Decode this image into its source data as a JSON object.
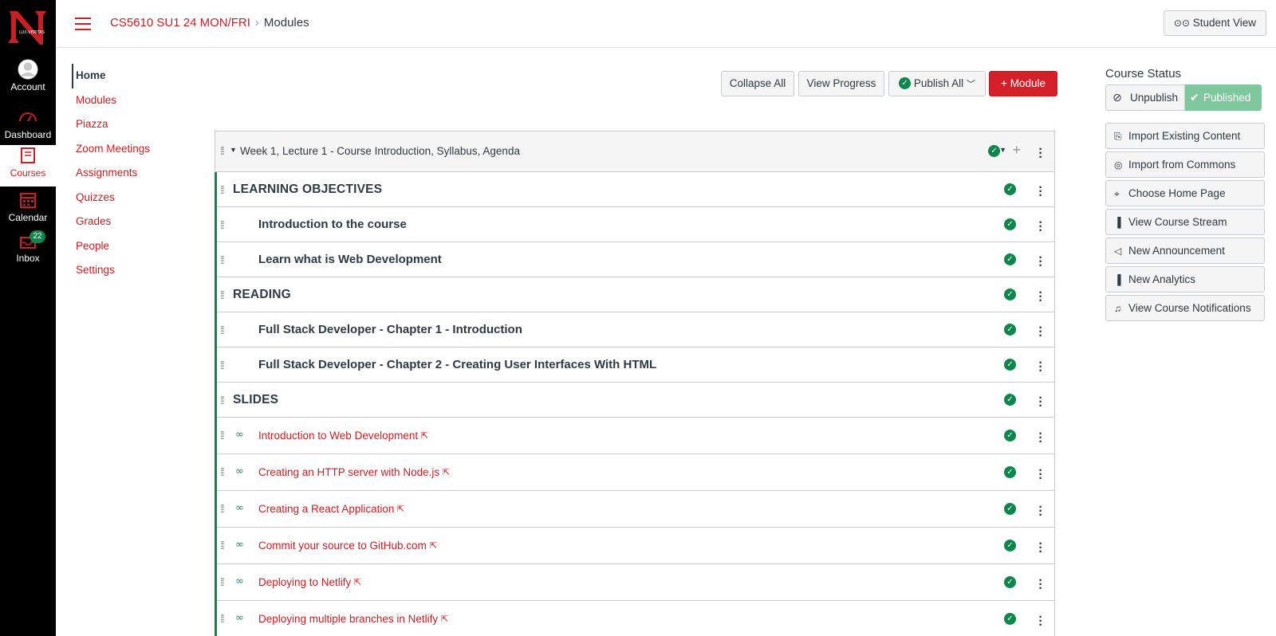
{
  "global_nav": {
    "items": [
      {
        "label": "Account",
        "icon": "avatar-icon"
      },
      {
        "label": "Dashboard",
        "icon": "dashboard-icon"
      },
      {
        "label": "Courses",
        "icon": "courses-icon"
      },
      {
        "label": "Calendar",
        "icon": "calendar-icon"
      },
      {
        "label": "Inbox",
        "icon": "inbox-icon",
        "badge": "22"
      }
    ]
  },
  "header": {
    "course": "CS5610 SU1 24 MON/FRI",
    "separator": "›",
    "page": "Modules",
    "student_view": "Student View"
  },
  "course_nav": {
    "items": [
      "Home",
      "Modules",
      "Piazza",
      "Zoom Meetings",
      "Assignments",
      "Quizzes",
      "Grades",
      "People",
      "Settings"
    ]
  },
  "toolbar": {
    "collapse_all": "Collapse All",
    "view_progress": "View Progress",
    "publish_all": "Publish All",
    "add_module": "Module"
  },
  "module": {
    "title": "Week 1, Lecture 1 - Course Introduction, Syllabus, Agenda",
    "items": [
      {
        "type": "header",
        "title": "LEARNING OBJECTIVES"
      },
      {
        "type": "sub",
        "title": "Introduction to the course"
      },
      {
        "type": "sub",
        "title": "Learn what is Web Development"
      },
      {
        "type": "header",
        "title": "READING"
      },
      {
        "type": "sub",
        "title": "Full Stack Developer - Chapter 1 - Introduction"
      },
      {
        "type": "sub",
        "title": "Full Stack Developer - Chapter 2 - Creating User Interfaces With HTML"
      },
      {
        "type": "header",
        "title": "SLIDES"
      },
      {
        "type": "link",
        "title": "Introduction to Web Development"
      },
      {
        "type": "link",
        "title": "Creating an HTTP server with Node.js"
      },
      {
        "type": "link",
        "title": "Creating a React Application"
      },
      {
        "type": "link",
        "title": "Commit your source to GitHub.com"
      },
      {
        "type": "link",
        "title": "Deploying to Netlify"
      },
      {
        "type": "link",
        "title": "Deploying multiple branches in Netlify"
      }
    ]
  },
  "sidebar": {
    "course_status_title": "Course Status",
    "unpublish": "Unpublish",
    "published": "Published",
    "buttons": [
      {
        "label": "Import Existing Content",
        "icon": "import-icon"
      },
      {
        "label": "Import from Commons",
        "icon": "commons-icon"
      },
      {
        "label": "Choose Home Page",
        "icon": "target-icon"
      },
      {
        "label": "View Course Stream",
        "icon": "bar-chart-icon"
      },
      {
        "label": "New Announcement",
        "icon": "megaphone-icon"
      },
      {
        "label": "New Analytics",
        "icon": "analytics-icon"
      },
      {
        "label": "View Course Notifications",
        "icon": "bell-icon"
      }
    ]
  },
  "colors": {
    "brand_red": "#c71f23",
    "success_green": "#0b874b",
    "published_green": "#7fc79c"
  }
}
